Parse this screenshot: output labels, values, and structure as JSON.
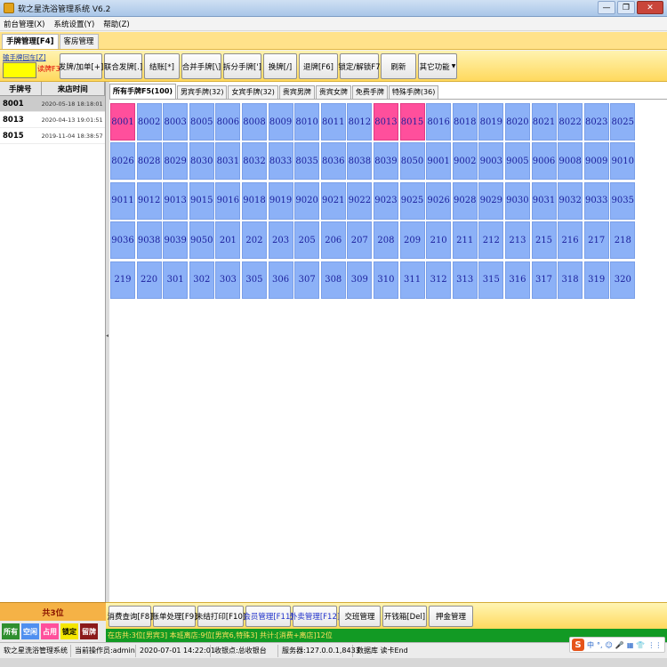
{
  "window": {
    "title": "软之星洗浴管理系统 V6.2",
    "controls": [
      "—",
      "❐",
      "✕"
    ]
  },
  "menu": [
    "前台管理(X)",
    "系统设置(Y)",
    "帮助(Z)"
  ],
  "top_tabs": [
    {
      "label": "手牌管理[F4]",
      "active": true
    },
    {
      "label": "客房管理",
      "active": false
    }
  ],
  "scan": {
    "label": "输手牌回车[Z]",
    "read_label": "读牌F3"
  },
  "toolbar": [
    "发牌/加单[+]",
    "联合发牌[.]",
    "结账[*]",
    "合并手牌[\\]",
    "拆分手牌[']",
    "换牌[/]",
    "退牌[F6]",
    "锁定/解锁F7",
    "刷新",
    "其它功能"
  ],
  "left_panel": {
    "headers": [
      "手牌号",
      "来店时间"
    ],
    "rows": [
      {
        "id": "8001",
        "time": "2020-05-18 18:18:01",
        "selected": true
      },
      {
        "id": "8013",
        "time": "2020-04-13 19:01:51",
        "selected": false
      },
      {
        "id": "8015",
        "time": "2019-11-04 18:38:57",
        "selected": false
      }
    ],
    "total": "共3位"
  },
  "sub_tabs": [
    {
      "label": "所有手牌F5(100)",
      "active": true
    },
    {
      "label": "男宾手牌(32)",
      "active": false
    },
    {
      "label": "女宾手牌(32)",
      "active": false
    },
    {
      "label": "贵宾男牌",
      "active": false
    },
    {
      "label": "贵宾女牌",
      "active": false
    },
    {
      "label": "免费手牌",
      "active": false
    },
    {
      "label": "特殊手牌(36)",
      "active": false
    }
  ],
  "tiles": [
    "8001",
    "8002",
    "8003",
    "8005",
    "8006",
    "8008",
    "8009",
    "8010",
    "8011",
    "8012",
    "8013",
    "8015",
    "8016",
    "8018",
    "8019",
    "8020",
    "8021",
    "8022",
    "8023",
    "8025",
    "8026",
    "8028",
    "8029",
    "8030",
    "8031",
    "8032",
    "8033",
    "8035",
    "8036",
    "8038",
    "8039",
    "8050",
    "9001",
    "9002",
    "9003",
    "9005",
    "9006",
    "9008",
    "9009",
    "9010",
    "9011",
    "9012",
    "9013",
    "9015",
    "9016",
    "9018",
    "9019",
    "9020",
    "9021",
    "9022",
    "9023",
    "9025",
    "9026",
    "9028",
    "9029",
    "9030",
    "9031",
    "9032",
    "9033",
    "9035",
    "9036",
    "9038",
    "9039",
    "9050",
    "201",
    "202",
    "203",
    "205",
    "206",
    "207",
    "208",
    "209",
    "210",
    "211",
    "212",
    "213",
    "215",
    "216",
    "217",
    "218",
    "219",
    "220",
    "301",
    "302",
    "303",
    "305",
    "306",
    "307",
    "308",
    "309",
    "310",
    "311",
    "312",
    "313",
    "315",
    "316",
    "317",
    "318",
    "319",
    "320"
  ],
  "occupied": [
    "8001",
    "8013",
    "8015"
  ],
  "bottom_buttons": [
    {
      "label": "消费查询[F8]",
      "link": false
    },
    {
      "label": "账单处理[F9]",
      "link": false
    },
    {
      "label": "未结打印[F10]",
      "link": false
    },
    {
      "label": "会员管理[F11]",
      "link": true
    },
    {
      "label": "外卖管理[F12]",
      "link": true
    },
    {
      "label": "交班管理",
      "link": false
    },
    {
      "label": "开钱箱[Del]",
      "link": false
    },
    {
      "label": "押金管理",
      "link": false
    }
  ],
  "legend": [
    {
      "label": "所有",
      "color": "#2f8f2f"
    },
    {
      "label": "空闲",
      "color": "#4f8ff0"
    },
    {
      "label": "占用",
      "color": "#ff4f9c"
    },
    {
      "label": "锁定",
      "color": "#f4e600",
      "text": "#000000"
    },
    {
      "label": "留牌",
      "color": "#8b1a1a"
    }
  ],
  "summary": "在店共:3位[男宾3] 本班离店:9位[男宾6,特殊3] 共计:[消费+离店]12位",
  "status": [
    "软之星洗浴管理系统",
    "当前操作员:admin",
    "2020-07-01 14:22:01",
    "收银点:总收银台",
    "服务器:127.0.0.1,8433",
    "数据库 读卡End"
  ],
  "ime": {
    "logo": "S",
    "symbols": [
      "中",
      "°,",
      "☺",
      "🎤",
      "▦",
      "👕",
      "⋮⋮"
    ]
  }
}
